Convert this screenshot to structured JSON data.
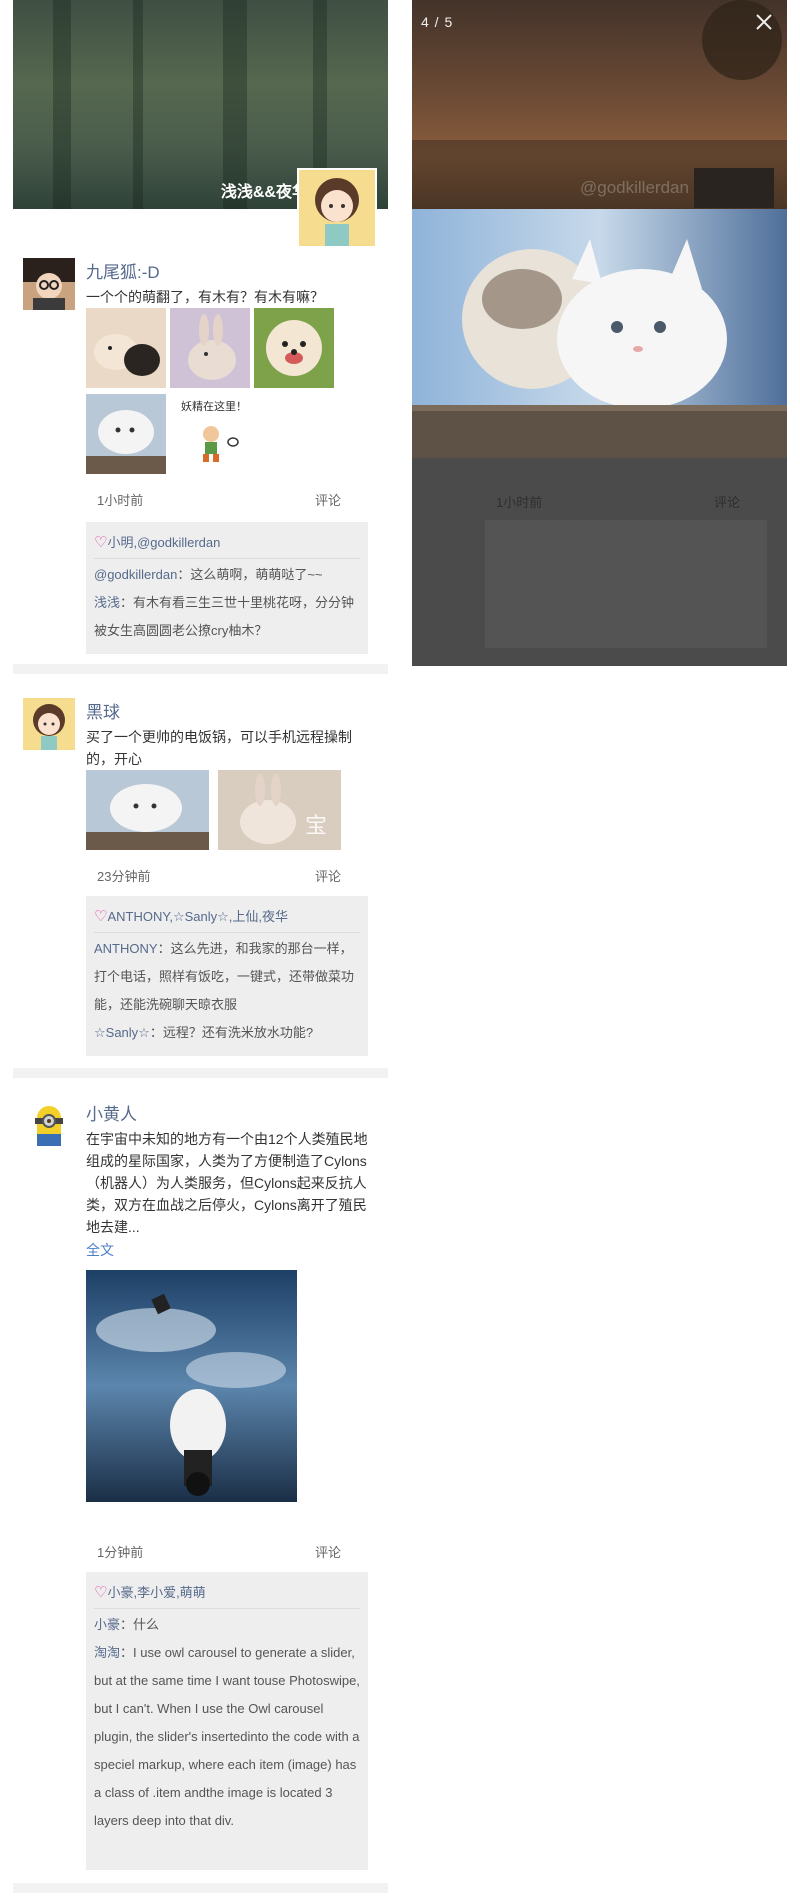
{
  "cover": {
    "username": "浅浅&&夜华"
  },
  "viewer": {
    "counter": "4 / 5",
    "watermark": "@godkillerdan"
  },
  "posts": [
    {
      "author": "九尾狐:-D",
      "text": "一个个的萌翻了，有木有？有木有嘛？",
      "sticker_text": "妖精在这里！",
      "time": "1小时前",
      "comment_label": "评论",
      "likes": "小明,@godkillerdan",
      "comments": [
        {
          "name": "@godkillerdan",
          "text": "：这么萌啊，萌萌哒了~~"
        },
        {
          "name": "浅浅",
          "text": "：有木有看三生三世十里桃花呀，分分钟被女生高圆圆老公撩cry柚木？"
        }
      ]
    },
    {
      "author": "黑球",
      "text": "买了一个更帅的电饭锅，可以手机远程操制的，开心",
      "image_watermark": "宝",
      "time": "23分钟前",
      "comment_label": "评论",
      "likes": "ANTHONY,☆Sanly☆,上仙,夜华",
      "comments": [
        {
          "name": "ANTHONY",
          "text": "：这么先进，和我家的那台一样，打个电话，照样有饭吃，一键式，还带做菜功能，还能洗碗聊天晾衣服"
        },
        {
          "name": "☆Sanly☆",
          "text": "：远程？还有洗米放水功能?"
        }
      ]
    },
    {
      "author": "小黄人",
      "text": "在宇宙中未知的地方有一个由12个人类殖民地组成的星际国家，人类为了方便制造了Cylons（机器人）为人类服务，但Cylons起来反抗人类，双方在血战之后停火，Cylons离开了殖民地去建...",
      "more_link": "全文",
      "time": "1分钟前",
      "comment_label": "评论",
      "likes": "小豪,李小爱,萌萌",
      "comments": [
        {
          "name": "小豪",
          "text": "：什么"
        },
        {
          "name": "淘淘",
          "text": "：I use owl carousel to generate a slider, but at the same time I want touse Photoswipe, but I can't. When I use the Owl carousel plugin, the slider's insertedinto the code with a speciel markup, where each item (image) has a class of .item andthe image is located 3 layers deep into that div."
        }
      ]
    }
  ],
  "icons": {
    "heart": "heart-icon",
    "close": "close-icon"
  },
  "colors": {
    "name_blue": "#566a8c",
    "link_blue": "#4a7ec9",
    "heart_pink": "#e23ea2",
    "comment_bg": "#eeeeee"
  }
}
